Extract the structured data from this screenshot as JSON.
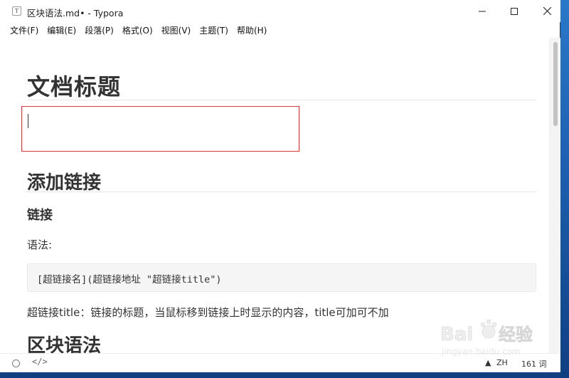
{
  "window": {
    "title": "区块语法.md• - Typora",
    "app_icon_glyph": "T"
  },
  "menu": [
    {
      "label": "文件(F)"
    },
    {
      "label": "编辑(E)"
    },
    {
      "label": "段落(P)"
    },
    {
      "label": "格式(O)"
    },
    {
      "label": "视图(V)"
    },
    {
      "label": "主题(T)"
    },
    {
      "label": "帮助(H)"
    }
  ],
  "document": {
    "title": "文档标题",
    "section1_heading": "添加链接",
    "subsection_heading": "链接",
    "syntax_label": "语法:",
    "code": "[超链接名](超链接地址 \"超链接title\")",
    "description": "超链接title：链接的标题，当鼠标移到链接上时显示的内容，title可加可不加",
    "section2_heading": "区块语法"
  },
  "statusbar": {
    "code_toggle_glyph": "</>",
    "warning_glyph": "▲",
    "language": "ZH",
    "word_count": "161 词"
  },
  "colors": {
    "edit_box_border": "#d93a3a",
    "text": "#333333",
    "desktop": "#1b5aa3"
  },
  "icons": [
    "typora-app-icon",
    "minimize-icon",
    "maximize-icon",
    "close-icon",
    "source-mode-icon",
    "warning-icon",
    "outline-toggle-icon"
  ],
  "watermark_text": "jingyan.baidu.com"
}
